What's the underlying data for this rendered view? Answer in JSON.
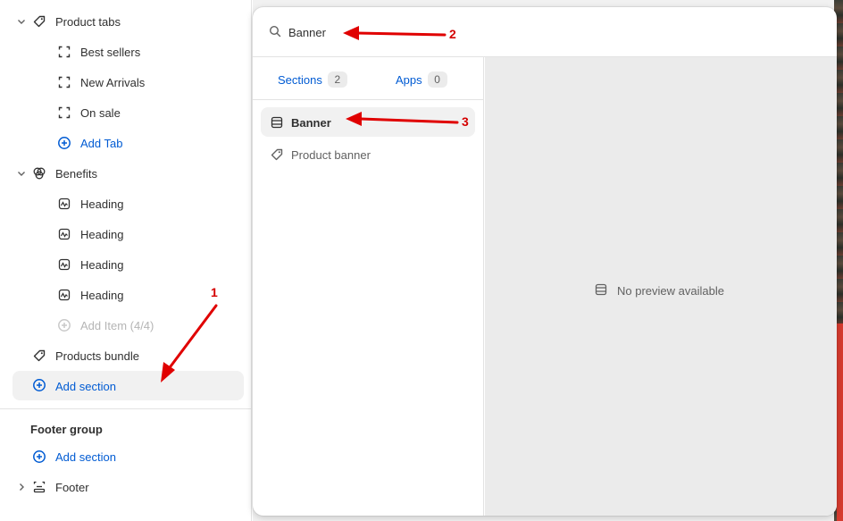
{
  "sidebar": {
    "items": [
      {
        "label": "Product tabs"
      },
      {
        "label": "Best sellers"
      },
      {
        "label": "New Arrivals"
      },
      {
        "label": "On sale"
      },
      {
        "label": "Add Tab"
      },
      {
        "label": "Benefits"
      },
      {
        "label": "Heading"
      },
      {
        "label": "Heading"
      },
      {
        "label": "Heading"
      },
      {
        "label": "Heading"
      },
      {
        "label": "Add Item (4/4)"
      },
      {
        "label": "Products bundle"
      },
      {
        "label": "Add section"
      }
    ],
    "footer_group": {
      "title": "Footer group",
      "add_section": "Add section",
      "footer": "Footer"
    }
  },
  "picker": {
    "search": {
      "value": "Banner",
      "icon": "search-icon"
    },
    "tabs": [
      {
        "label": "Sections",
        "count": "2"
      },
      {
        "label": "Apps",
        "count": "0"
      }
    ],
    "results": [
      {
        "label": "Banner",
        "icon": "section-icon"
      },
      {
        "label": "Product banner",
        "icon": "tag-icon"
      }
    ],
    "preview": {
      "empty_text": "No preview available"
    }
  },
  "annotations": [
    "1",
    "2",
    "3"
  ],
  "colors": {
    "accent": "#005bd3",
    "arrow": "#e00000",
    "selected_bg": "#f1f1f1"
  }
}
